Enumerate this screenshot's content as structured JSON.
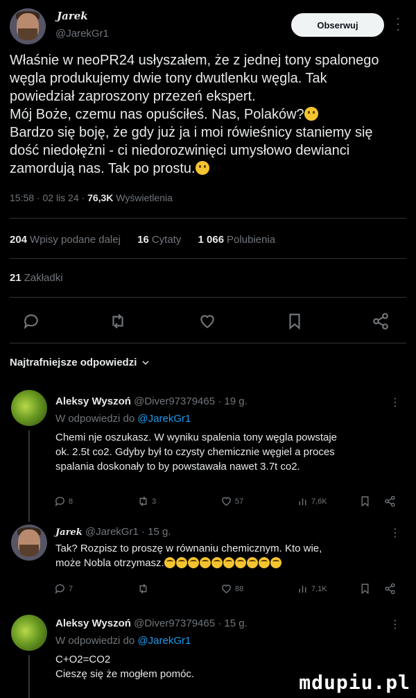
{
  "header": {
    "display_name": "Jarek",
    "handle": "@JarekGr1",
    "follow_label": "Obserwuj",
    "more": "⋮"
  },
  "post": {
    "lines": [
      "Właśnie w neoPR24 usłyszałem, że z jednej tony spalonego",
      "węgla produkujemy dwie tony dwutlenku węgla. Tak",
      "powiedział zaproszony przezeń ekspert.",
      "Mój Boże, czemu nas opuściłeś. Nas, Polaków?",
      "Bardzo się boję, że gdy już ja i moi rówieśnicy staniemy się",
      "dość niedołężni - ci niedorozwinięci umysłowo dewianci",
      "zamordują nas. Tak po prostu."
    ],
    "meta_time": "15:58 · 02 lis 24 · ",
    "meta_views": "76,3K",
    "meta_views_label": " Wyświetlenia"
  },
  "stats": {
    "reposts_count": "204",
    "reposts_label": "Wpisy podane dalej",
    "quotes_count": "16",
    "quotes_label": "Cytaty",
    "likes_count": "1 066",
    "likes_label": "Polubienia",
    "bookmarks_count": "21",
    "bookmarks_label": "Zakładki"
  },
  "top_replies_label": "Najtrafniejsze odpowiedzi",
  "replies": [
    {
      "name": "Aleksy Wyszoń",
      "handle": "@Diver97379465 · 19 g.",
      "in_reply_prefix": "W odpowiedzi do ",
      "in_reply_handle": "@JarekGr1",
      "text_lines": [
        "Chemi nje oszukasz. W wyniku spalenia tony węgla powstaje",
        "ok. 2.5t co2. Gdyby był to czysty chemicznie węgiel a proces",
        "spalania doskonały to by powstawała nawet 3.7t co2."
      ],
      "replies": "8",
      "reposts": "3",
      "likes": "57",
      "views": "7,6K"
    },
    {
      "name": "Jarek",
      "handle": "@JarekGr1 · 15 g.",
      "text_lines": [
        "Tak? Rozpisz to proszę w równaniu chemicznym. Kto wie,",
        "może Nobla otrzymasz."
      ],
      "replies": "7",
      "reposts": "",
      "likes": "88",
      "views": "7,1K"
    },
    {
      "name": "Aleksy Wyszoń",
      "handle": "@Diver97379465 · 15 g.",
      "in_reply_prefix": "W odpowiedzi do ",
      "in_reply_handle": "@JarekGr1",
      "text_lines": [
        "C+O2=CO2",
        "Cieszę się że mogłem pomóc."
      ]
    }
  ],
  "watermark": "mdupiu.pl"
}
